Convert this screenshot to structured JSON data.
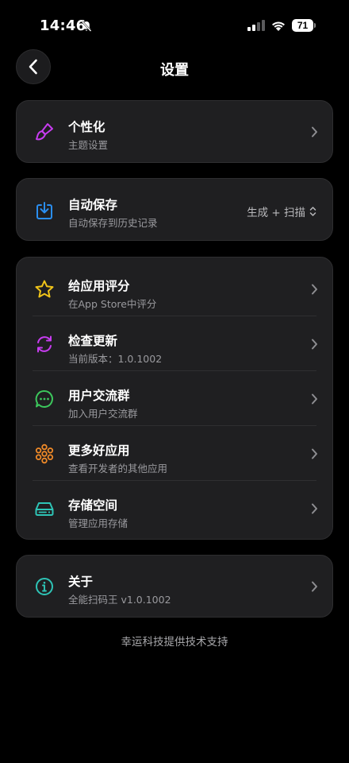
{
  "status_bar": {
    "time": "14:46",
    "battery": "71"
  },
  "nav": {
    "title": "设置"
  },
  "personalization": {
    "title": "个性化",
    "subtitle": "主题设置"
  },
  "autosave": {
    "title": "自动保存",
    "subtitle": "自动保存到历史记录",
    "value": "生成 + 扫描"
  },
  "list": [
    {
      "title": "给应用评分",
      "subtitle": "在App Store中评分"
    },
    {
      "title": "检查更新",
      "subtitle": "当前版本：1.0.1002"
    },
    {
      "title": "用户交流群",
      "subtitle": "加入用户交流群"
    },
    {
      "title": "更多好应用",
      "subtitle": "查看开发者的其他应用"
    },
    {
      "title": "存储空间",
      "subtitle": "管理应用存储"
    }
  ],
  "about": {
    "title": "关于",
    "subtitle": "全能扫码王 v1.0.1002"
  },
  "footer": "幸运科技提供技术支持",
  "colors": {
    "brush": "#c73cf0",
    "download": "#2a8ef0",
    "star": "#f0c419",
    "refresh": "#c73cf0",
    "chat": "#3cc65c",
    "flower": "#f08a28",
    "storage": "#2ec4b6",
    "info": "#2ec4b6"
  },
  "icons": [
    "brush-icon",
    "download-icon",
    "star-icon",
    "refresh-icon",
    "chat-icon",
    "flower-icon",
    "storage-icon",
    "info-icon"
  ]
}
